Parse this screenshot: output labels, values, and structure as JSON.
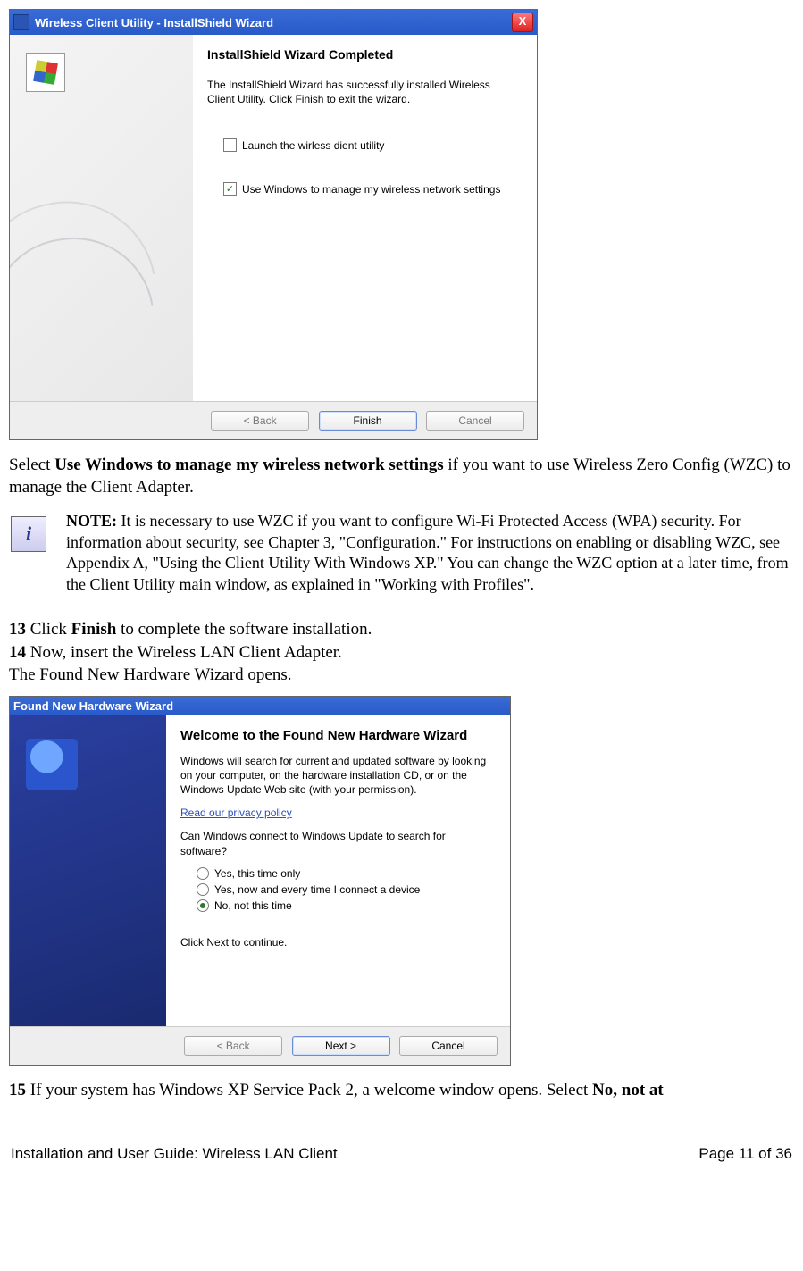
{
  "wizard1": {
    "title": "Wireless Client Utility - InstallShield Wizard",
    "heading": "InstallShield Wizard Completed",
    "body": "The InstallShield Wizard has successfully installed Wireless Client Utility. Click Finish to exit the wizard.",
    "check_launch": "Launch the wirless dient utility",
    "check_wzc": "Use Windows to manage my wireless network settings",
    "btn_back": "< Back",
    "btn_finish": "Finish",
    "btn_cancel": "Cancel"
  },
  "para_select_pre": "Select ",
  "para_select_bold": "Use Windows to manage my wireless network settings",
  "para_select_post": " if you want to use Wireless Zero Config (WZC) to manage the Client Adapter.",
  "note_label": "NOTE:",
  "note_body": " It is necessary to use WZC if you want to configure Wi-Fi Protected Access (WPA) security. For information about security, see Chapter 3, \"Configuration.\" For instructions on enabling or disabling WZC, see Appendix A, \"Using the Client Utility With Windows XP.\" You can change the WZC option at a later time, from the Client Utility main window, as explained in \"Working with Profiles\".",
  "step13_n": "13",
  "step13_pre": " Click ",
  "step13_b": "Finish",
  "step13_post": " to complete the software installation.",
  "step14_n": "14",
  "step14_txt": " Now, insert the Wireless LAN Client Adapter.",
  "step14_after": "The Found New Hardware Wizard opens.",
  "wizard2": {
    "title": "Found New Hardware Wizard",
    "heading": "Welcome to the Found New Hardware Wizard",
    "body1": "Windows will search for current and updated software by looking on your computer, on the hardware installation CD, or on the Windows Update Web site (with your permission).",
    "privacy": "Read our privacy policy",
    "question": "Can Windows connect to Windows Update to search for software?",
    "opt1": "Yes, this time only",
    "opt2": "Yes, now and every time I connect a device",
    "opt3": "No, not this time",
    "continue": "Click Next to continue.",
    "btn_back": "< Back",
    "btn_next": "Next >",
    "btn_cancel": "Cancel"
  },
  "step15_n": "15",
  "step15_pre": " If your system has Windows XP Service Pack 2, a welcome window opens. Select ",
  "step15_b": "No, not at",
  "footer_left": "Installation and User Guide: Wireless LAN Client",
  "footer_right": "Page 11 of 36"
}
